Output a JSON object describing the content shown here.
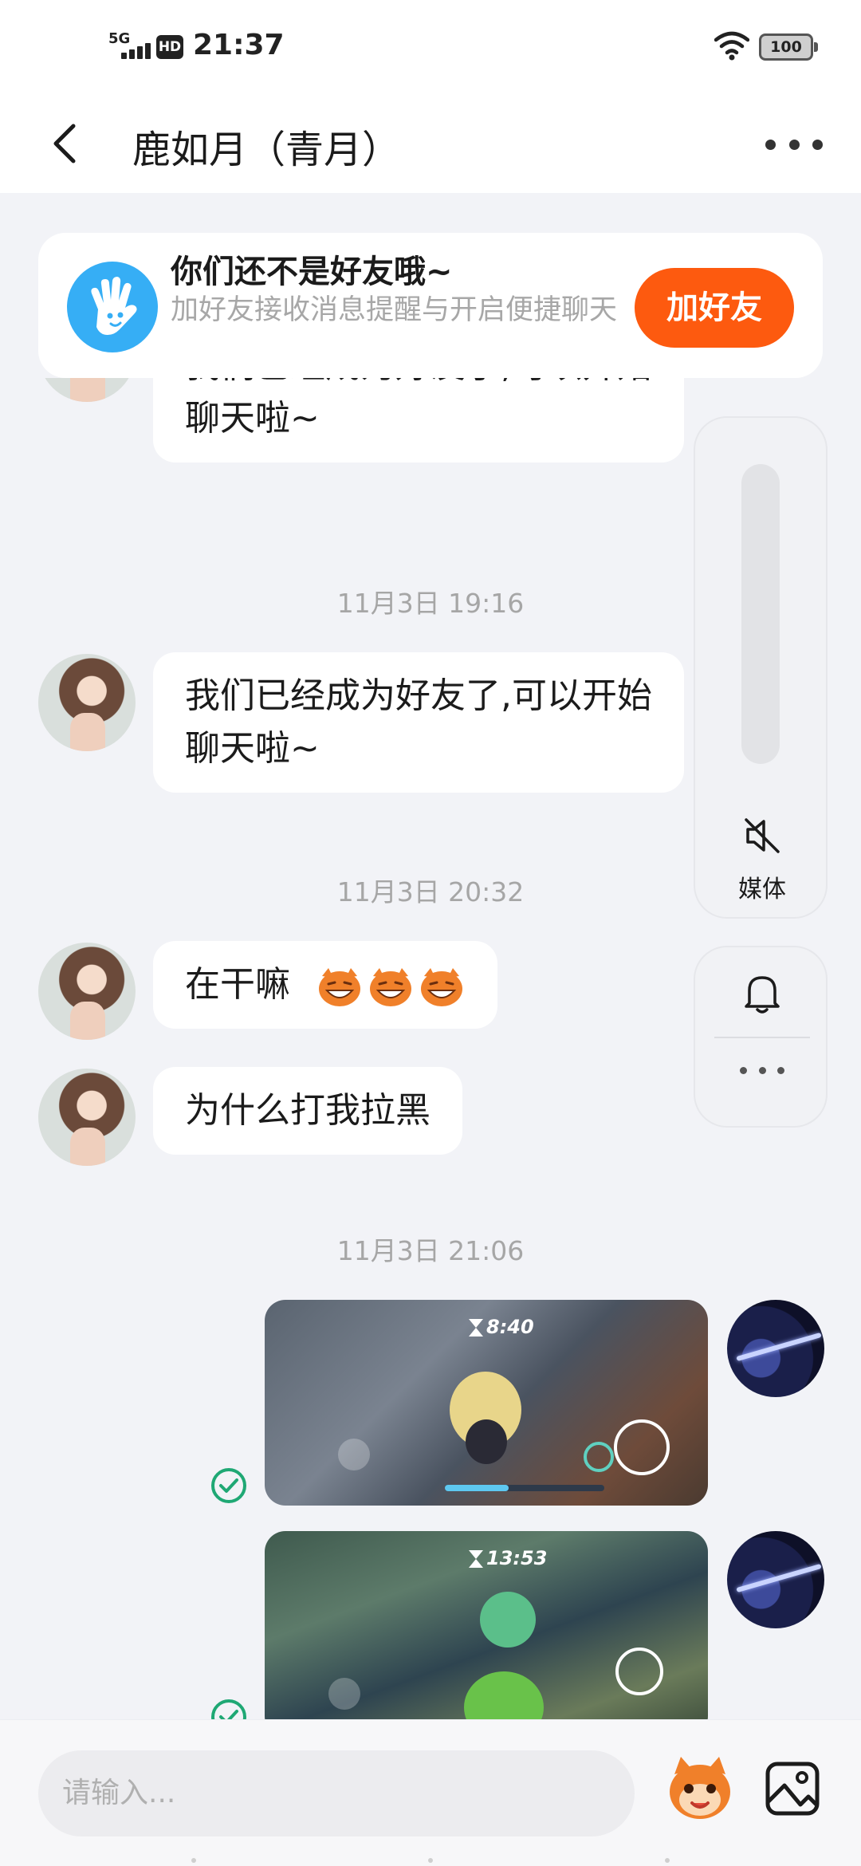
{
  "status_bar": {
    "network": "5G",
    "hd": "HD",
    "time": "21:37",
    "battery": "100"
  },
  "header": {
    "title": "鹿如月（青月）"
  },
  "friend_banner": {
    "title": "你们还不是好友哦~",
    "subtitle": "加好友接收消息提醒与开启便捷聊天",
    "button": "加好友"
  },
  "messages": [
    {
      "type": "text",
      "sender": "other",
      "text_line1": "我们已经成为好友了,可以开始",
      "text_line2": "聊天啦~"
    },
    {
      "type": "timestamp",
      "text": "11月3日 19:16"
    },
    {
      "type": "text",
      "sender": "other",
      "text_line1": "我们已经成为好友了,可以开始",
      "text_line2": "聊天啦~"
    },
    {
      "type": "timestamp",
      "text": "11月3日 20:32"
    },
    {
      "type": "text",
      "sender": "other",
      "text": "在干嘛"
    },
    {
      "type": "text",
      "sender": "other",
      "text": "为什么打我拉黑"
    },
    {
      "type": "timestamp",
      "text": "11月3日 21:06"
    },
    {
      "type": "image",
      "sender": "me",
      "hud_time": "8:40",
      "status": "read"
    },
    {
      "type": "image",
      "sender": "me",
      "hud_time": "13:53",
      "status": "read"
    }
  ],
  "side_panel": {
    "media_label": "媒体"
  },
  "input_bar": {
    "placeholder": "请输入..."
  },
  "colors": {
    "accent_orange": "#fd5a0f",
    "banner_icon_blue": "#36aef5",
    "read_check_green": "#1fa874",
    "background": "#f2f3f7"
  },
  "icons": [
    "back-arrow-icon",
    "more-dots-icon",
    "waving-hand-icon",
    "mute-icon",
    "bell-icon",
    "image-icon",
    "emoji-icon",
    "check-icon"
  ]
}
